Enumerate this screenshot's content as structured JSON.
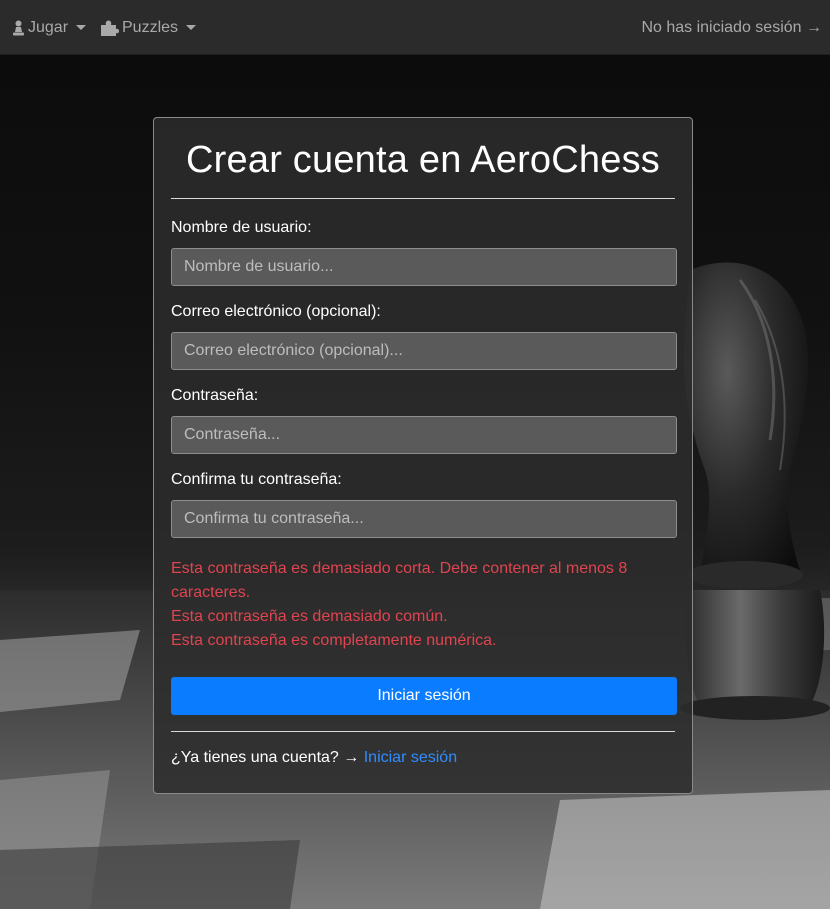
{
  "navbar": {
    "play_label": "Jugar",
    "puzzles_label": "Puzzles",
    "login_status": "No has iniciado sesión →",
    "play_icon": "pawn-icon",
    "puzzles_icon": "puzzle-icon"
  },
  "form": {
    "title": "Crear cuenta en AeroChess",
    "username": {
      "label": "Nombre de usuario:",
      "placeholder": "Nombre de usuario...",
      "value": ""
    },
    "email": {
      "label": "Correo electrónico (opcional):",
      "placeholder": "Correo electrónico (opcional)...",
      "value": ""
    },
    "password": {
      "label": "Contraseña:",
      "placeholder": "Contraseña...",
      "value": ""
    },
    "confirm_password": {
      "label": "Confirma tu contraseña:",
      "placeholder": "Confirma tu contraseña...",
      "value": ""
    },
    "errors": [
      "Esta contraseña es demasiado corta. Debe contener al menos 8 caracteres.",
      "Esta contraseña es demasiado común.",
      "Esta contraseña es completamente numérica."
    ],
    "submit_label": "Iniciar sesión",
    "footer_prompt": "¿Ya tienes una cuenta? →",
    "footer_link": "Iniciar sesión"
  },
  "colors": {
    "accent": "#0a7cff",
    "error": "#e0444f",
    "link": "#2f8cff",
    "navbar_bg": "#2b2b2b"
  }
}
